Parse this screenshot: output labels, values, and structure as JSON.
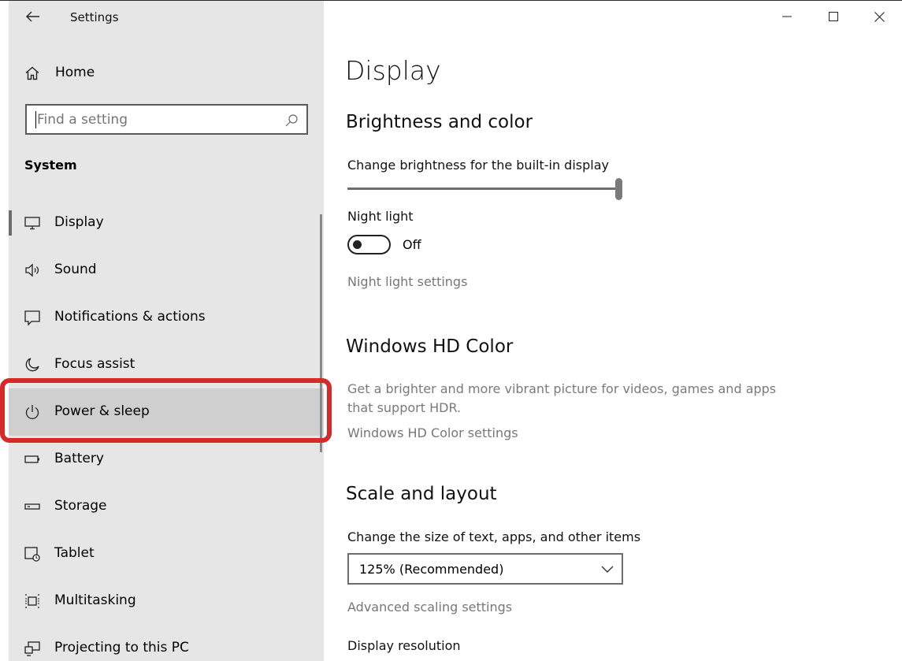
{
  "window": {
    "title": "Settings"
  },
  "sidebar": {
    "home_label": "Home",
    "search_placeholder": "Find a setting",
    "section_label": "System",
    "items": [
      {
        "label": "Display",
        "icon": "monitor-icon"
      },
      {
        "label": "Sound",
        "icon": "speaker-icon"
      },
      {
        "label": "Notifications & actions",
        "icon": "notification-icon"
      },
      {
        "label": "Focus assist",
        "icon": "moon-icon"
      },
      {
        "label": "Power & sleep",
        "icon": "power-icon"
      },
      {
        "label": "Battery",
        "icon": "battery-icon"
      },
      {
        "label": "Storage",
        "icon": "storage-icon"
      },
      {
        "label": "Tablet",
        "icon": "tablet-icon"
      },
      {
        "label": "Multitasking",
        "icon": "multitasking-icon"
      },
      {
        "label": "Projecting to this PC",
        "icon": "projecting-icon"
      }
    ]
  },
  "main": {
    "page_title": "Display",
    "brightness": {
      "heading": "Brightness and color",
      "slider_label": "Change brightness for the built-in display",
      "value_percent": 100
    },
    "night_light": {
      "label": "Night light",
      "state": "Off",
      "settings_link": "Night light settings"
    },
    "hd_color": {
      "heading": "Windows HD Color",
      "description": "Get a brighter and more vibrant picture for videos, games and apps that support HDR.",
      "settings_link": "Windows HD Color settings"
    },
    "scale": {
      "heading": "Scale and layout",
      "size_label": "Change the size of text, apps, and other items",
      "size_value": "125% (Recommended)",
      "advanced_link": "Advanced scaling settings",
      "resolution_label": "Display resolution"
    }
  },
  "colors": {
    "sidebar_bg": "#e6e6e6",
    "highlight": "#d42a2a",
    "hover_bg": "#cfcfcf"
  }
}
